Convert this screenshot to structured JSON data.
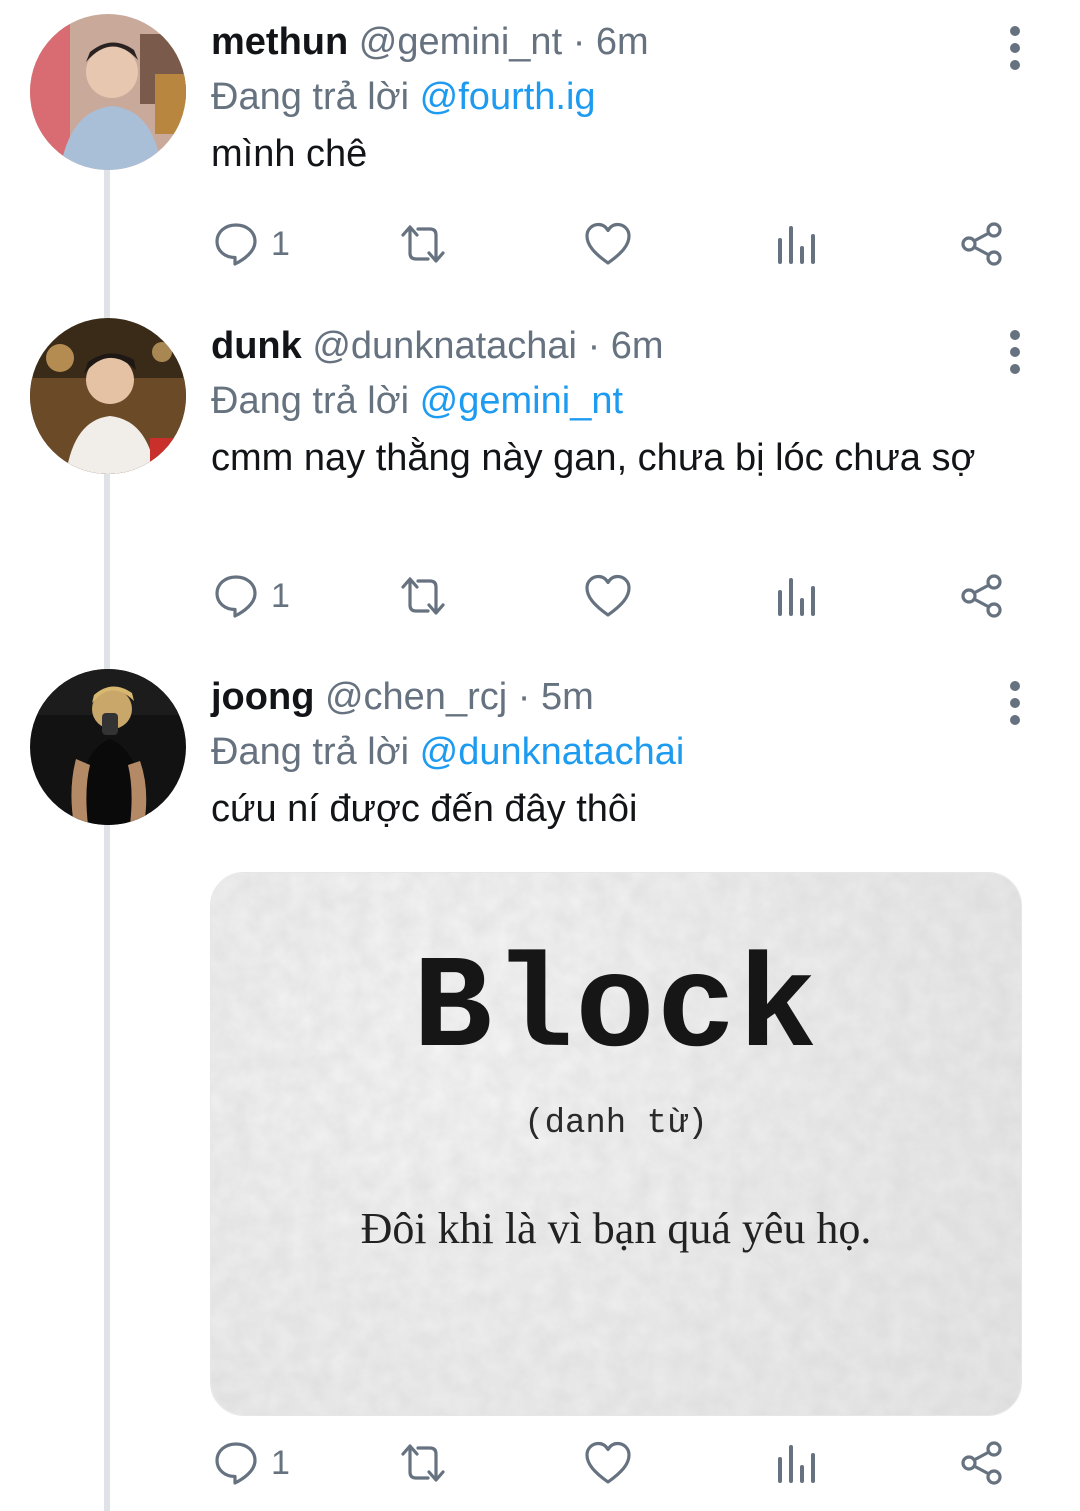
{
  "tweets": [
    {
      "name": "methun",
      "handle": "@gemini_nt",
      "separator": "·",
      "time": "6m",
      "replying_prefix": "Đang trả lời",
      "replying_to": "@fourth.ig",
      "text": "mình chê",
      "reply_count": "1"
    },
    {
      "name": "dunk",
      "handle": "@dunknatachai",
      "separator": "·",
      "time": "6m",
      "replying_prefix": "Đang trả lời",
      "replying_to": "@gemini_nt",
      "text": "cmm nay thằng này gan, chưa bị lóc chưa sợ",
      "reply_count": "1"
    },
    {
      "name": "joong",
      "handle": "@chen_rcj",
      "separator": "·",
      "time": "5m",
      "replying_prefix": "Đang trả lời",
      "replying_to": "@dunknatachai",
      "text": "cứu ní được đến đây thôi",
      "reply_count": "1",
      "media": {
        "word": "Block",
        "part_of_speech": "(danh từ)",
        "definition": "Đôi khi là vì bạn quá yêu họ."
      }
    }
  ],
  "icons": {
    "reply": "speech-bubble-icon",
    "retweet": "retweet-icon",
    "like": "heart-icon",
    "views": "bar-chart-icon",
    "share": "share-icon",
    "more": "more-vertical-icon"
  },
  "colors": {
    "accent": "#1d9bf0",
    "muted": "#66727f",
    "text": "#121417",
    "thread_line": "#dfe3e7"
  }
}
